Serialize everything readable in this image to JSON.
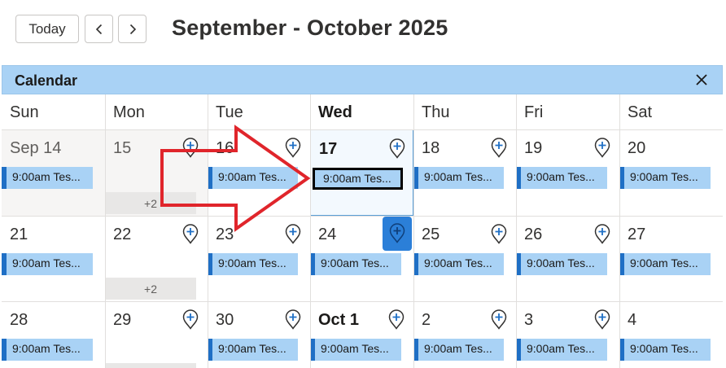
{
  "toolbar": {
    "today_label": "Today",
    "range_title": "September - October 2025"
  },
  "calendar": {
    "title": "Calendar"
  },
  "weekdays": [
    "Sun",
    "Mon",
    "Tue",
    "Wed",
    "Thu",
    "Fri",
    "Sat"
  ],
  "weeks": [
    [
      {
        "day": "Sep 14",
        "event": "9:00am Tes...",
        "past": true
      },
      {
        "day": "15",
        "add": true,
        "more": "+2",
        "past": true
      },
      {
        "day": "16",
        "add": true,
        "event": "9:00am Tes..."
      },
      {
        "day": "17",
        "bold": true,
        "add": true,
        "today": true,
        "event": "9:00am Tes...",
        "selected": true
      },
      {
        "day": "18",
        "add": true,
        "event": "9:00am Tes..."
      },
      {
        "day": "19",
        "add": true,
        "event": "9:00am Tes..."
      },
      {
        "day": "20",
        "event": "9:00am Tes..."
      }
    ],
    [
      {
        "day": "21",
        "event": "9:00am Tes..."
      },
      {
        "day": "22",
        "add": true,
        "more": "+2"
      },
      {
        "day": "23",
        "add": true,
        "event": "9:00am Tes..."
      },
      {
        "day": "24",
        "add": true,
        "add_active": true,
        "event": "9:00am Tes..."
      },
      {
        "day": "25",
        "add": true,
        "event": "9:00am Tes..."
      },
      {
        "day": "26",
        "add": true,
        "event": "9:00am Tes..."
      },
      {
        "day": "27",
        "event": "9:00am Tes..."
      }
    ],
    [
      {
        "day": "28",
        "event": "9:00am Tes..."
      },
      {
        "day": "29",
        "add": true
      },
      {
        "day": "30",
        "add": true,
        "event": "9:00am Tes..."
      },
      {
        "day": "Oct 1",
        "bold": true,
        "add": true,
        "event": "9:00am Tes..."
      },
      {
        "day": "2",
        "add": true,
        "event": "9:00am Tes..."
      },
      {
        "day": "3",
        "add": true,
        "event": "9:00am Tes..."
      },
      {
        "day": "4",
        "event": "9:00am Tes..."
      }
    ]
  ],
  "colors": {
    "header_bar": "#a9d2f5",
    "event_fill": "#a9d2f5",
    "event_accent": "#1f6fc5",
    "annotation_arrow": "#e0252b",
    "add_active": "#2b7fd8"
  }
}
